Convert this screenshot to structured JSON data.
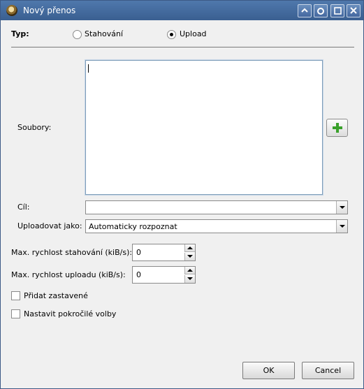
{
  "window": {
    "title": "Nový přenos",
    "buttons": [
      "help",
      "pin",
      "maximize",
      "close"
    ]
  },
  "type_row": {
    "label": "Typ:",
    "options": [
      {
        "label": "Stahování",
        "selected": false
      },
      {
        "label": "Upload",
        "selected": true
      }
    ]
  },
  "files": {
    "label": "Soubory:",
    "value": "",
    "add_icon": "plus-icon"
  },
  "target": {
    "label": "Cíl:",
    "value": ""
  },
  "upload_as": {
    "label": "Uploadovat jako:",
    "value": "Automaticky rozpoznat"
  },
  "speeds": {
    "download_label": "Max. rychlost stahování (kiB/s):",
    "download_value": "0",
    "upload_label": "Max. rychlost uploadu (kiB/s):",
    "upload_value": "0"
  },
  "options": {
    "add_paused": {
      "label": "Přidat zastavené",
      "checked": false
    },
    "advanced": {
      "label": "Nastavit pokročilé volby",
      "checked": false
    }
  },
  "actions": {
    "ok": "OK",
    "cancel": "Cancel"
  },
  "colors": {
    "titlebar": "#3a5f91",
    "dialog_bg": "#f0f0f0",
    "accent_plus": "#3aa12b"
  }
}
